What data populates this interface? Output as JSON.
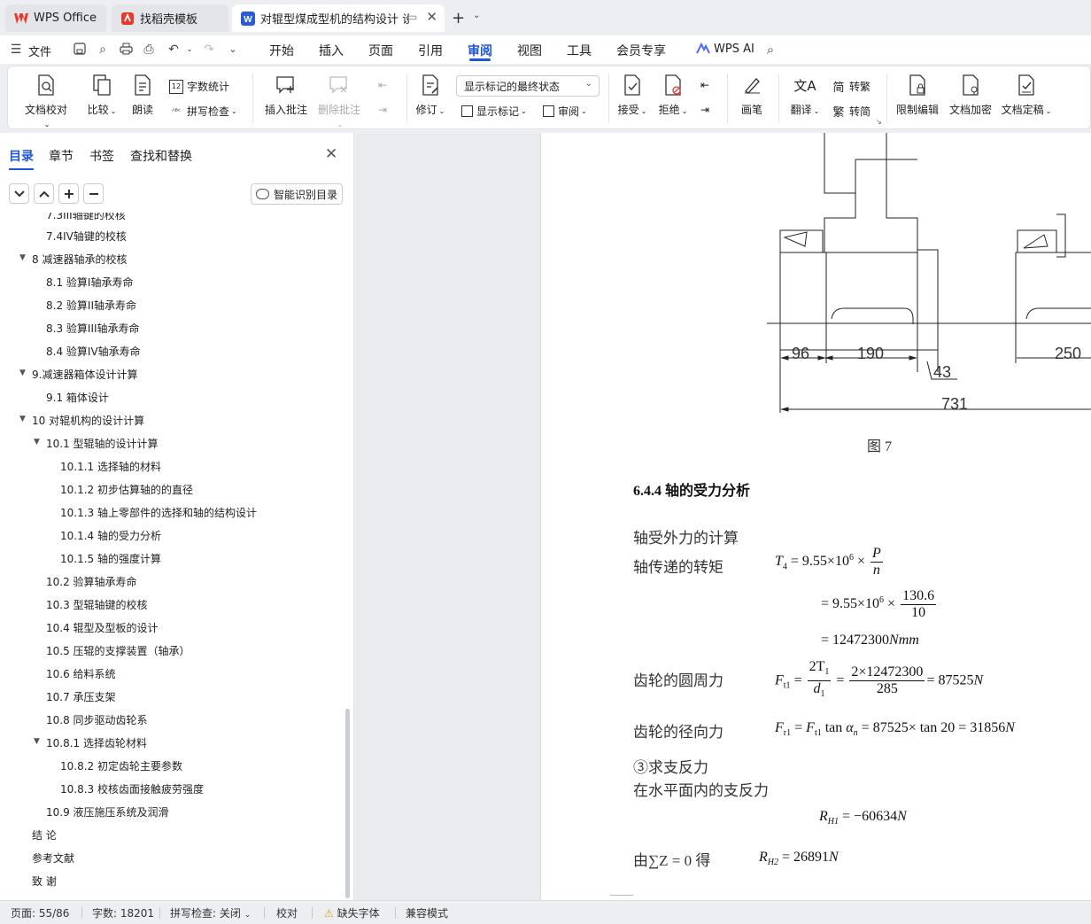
{
  "tabs": [
    {
      "label": "WPS Office"
    },
    {
      "label": "找稻壳模板"
    },
    {
      "label": "对辊型煤成型机的结构设计 设"
    }
  ],
  "menu": {
    "file": "文件",
    "items": [
      "开始",
      "插入",
      "页面",
      "引用",
      "审阅",
      "视图",
      "工具",
      "会员专享"
    ],
    "active": "审阅",
    "ai": "WPS AI"
  },
  "ribbon": {
    "proofread": "文档校对",
    "compare": "比较",
    "read_aloud": "朗读",
    "word_count": "字数统计",
    "spell_check": "拼写检查",
    "insert_comment": "插入批注",
    "delete_comment": "删除批注",
    "revise": "修订",
    "markup_state": "显示标记的最终状态",
    "show_markup": "显示标记",
    "review": "审阅",
    "accept": "接受",
    "reject": "拒绝",
    "pen": "画笔",
    "translate": "翻译",
    "to_traditional": "转繁",
    "to_simplified": "转简",
    "restrict_edit": "限制编辑",
    "encrypt": "文档加密",
    "finalize": "文档定稿"
  },
  "sidebar": {
    "tabs": [
      "目录",
      "章节",
      "书签",
      "查找和替换"
    ],
    "smart_toc": "智能识别目录",
    "toc": [
      {
        "text": "7.3III轴键的校核"
      },
      {
        "text": "7.4IV轴键的校核"
      },
      {
        "text": "8  减速器轴承的校核"
      },
      {
        "text": "8.1 验算I轴承寿命"
      },
      {
        "text": "8.2 验算II轴承寿命"
      },
      {
        "text": "8.3 验算III轴承寿命"
      },
      {
        "text": "8.4 验算IV轴承寿命"
      },
      {
        "text": "9.减速器箱体设计计算"
      },
      {
        "text": "9.1  箱体设计"
      },
      {
        "text": "10  对辊机构的设计计算"
      },
      {
        "text": "10.1 型辊轴的设计计算"
      },
      {
        "text": "10.1.1 选择轴的材料"
      },
      {
        "text": "10.1.2 初步估算轴的的直径"
      },
      {
        "text": "10.1.3 轴上零部件的选择和轴的结构设计"
      },
      {
        "text": "10.1.4  轴的受力分析"
      },
      {
        "text": "10.1.5 轴的强度计算"
      },
      {
        "text": "10.2 验算轴承寿命"
      },
      {
        "text": "10.3 型辊轴键的校核"
      },
      {
        "text": "10.4 辊型及型板的设计"
      },
      {
        "text": "10.5  压辊的支撑装置（轴承）"
      },
      {
        "text": "10.6  给料系统"
      },
      {
        "text": "10.7  承压支架"
      },
      {
        "text": "10.8  同步驱动齿轮系"
      },
      {
        "text": "10.8.1 选择齿轮材料"
      },
      {
        "text": "10.8.2 初定齿轮主要参数"
      },
      {
        "text": "10.8.3 校核齿面接触疲劳强度"
      },
      {
        "text": "10.9 液压施压系统及润滑"
      },
      {
        "text": "结      论"
      },
      {
        "text": "参考文献"
      },
      {
        "text": "致      谢"
      }
    ]
  },
  "document": {
    "dims": [
      "96",
      "190",
      "43",
      "250",
      "731"
    ],
    "figure_caption": "图    7",
    "heading": "6.4.4 轴的受力分析",
    "p_external": "轴受外力的计算",
    "p_torque": "轴传递的转矩",
    "p_circ": "齿轮的圆周力",
    "p_radial": "齿轮的径向力",
    "p_support": "③求支反力",
    "p_horizontal": "在水平面内的支反力",
    "p_from": "由∑Z = 0 得",
    "m_torque1_lhs": "T",
    "m_torque1_sub": "4",
    "m_torque1_mid": " = 9.55×10",
    "m_exp": "6",
    "m_times": " ×",
    "m_P": "P",
    "m_n": "n",
    "m_torque2_mid": "= 9.55×10",
    "m_1306": "130.6",
    "m_10": "10",
    "m_torque3": "= 12472300",
    "m_torque3_unit": "Nmm",
    "m_Ft": "F",
    "m_t1": "t1",
    "m_2T1": "2T",
    "m_sub1": "1",
    "m_d1": "d",
    "m_circ_num": "2×12472300",
    "m_circ_den": "285",
    "m_circ_res": "= 87525",
    "m_N": "N",
    "m_Fr": "F",
    "m_r1": "r1",
    "m_radial_mid": " tan ",
    "m_alpha": "α",
    "m_n_sub": "n",
    "m_radial_res": " = 87525× tan 20 = 31856",
    "m_R": "R",
    "m_H1": "H1",
    "m_H2": "H2",
    "m_RH1_res": " = −60634",
    "m_RH2_res": " = 26891"
  },
  "status": {
    "page": "页面: 55/86",
    "words": "字数: 18201",
    "spell": "拼写检查: 关闭",
    "proof": "校对",
    "missing_font": "缺失字体",
    "compat": "兼容模式"
  },
  "colors": {
    "accent": "#1d55d8",
    "wps_red": "#e8372c",
    "doc_blue": "#2b5cd6"
  }
}
